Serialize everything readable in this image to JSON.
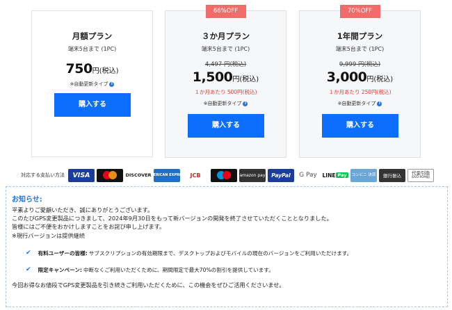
{
  "plans": [
    {
      "name": "月額プラン",
      "devices": "端末5台まで (1PC)",
      "price": "750",
      "price_unit": "円(税込)",
      "renewal": "※自動更新タイプ",
      "buy_label": "購入する"
    },
    {
      "badge": "66%OFF",
      "name": "３か月プラン",
      "devices": "端末5台まで (1PC)",
      "original_price": "4,497 円(税込)",
      "price": "1,500",
      "price_unit": "円(税込)",
      "per_month": "１か月あたり 500円(税込)",
      "renewal": "※自動更新タイプ",
      "buy_label": "購入する"
    },
    {
      "badge": "70%OFF",
      "name": "1年間プラン",
      "devices": "端末5台まで (1PC)",
      "original_price": "9,999 円(税込)",
      "price": "3,000",
      "price_unit": "円(税込)",
      "per_month": "１か月あたり 250円(税込)",
      "renewal": "※自動更新タイプ",
      "buy_label": "購入する"
    }
  ],
  "info_icon": "i",
  "payments": {
    "label": "対応する支払い方法",
    "methods": {
      "visa": "VISA",
      "discover": "DISCOVER",
      "amex": "AMERICAN EXPRESS",
      "jcb": "JCB",
      "amazon": "amazon pay",
      "paypal": "PayPal",
      "gpay": "G Pay",
      "line_text": "LINE",
      "line_pay": "Pay",
      "konbini": "コンビニ 決済",
      "bank": "銀行振込",
      "cod": "代金引換",
      "cod_sub": "(DVD-ROM版)"
    }
  },
  "notice": {
    "title": "お知らせ:",
    "lines": [
      "平素よりご愛顧いただき、誠にありがとうございます。",
      "このたびGPS変更製品につきまして、2024年9月30日をもって新バージョンの開発を終了させていただくこととなりました。",
      "皆様にはご不便をおかけしますことをお詫び申し上げます。",
      "※現行バージョンは提供継続"
    ],
    "bullets": [
      {
        "bold": "有料ユーザーの皆様:",
        "text": "サブスクリプションの有効期限まで、デスクトップおよびモバイルの現在のバージョンをご利用いただけます。"
      },
      {
        "bold": "限定キャンペーン:",
        "text": "中断なくご利用いただくために、期間限定で最大70%の割引を提供しています。"
      }
    ],
    "closing": "今回お得なお値段でGPS変更製品を引き続きご利用いただくために、この機会をぜひご活用くださいませ。"
  },
  "colors": {
    "accent": "#0d6efd",
    "badge": "#f26b6b",
    "discount_text": "#e53935",
    "notice_title": "#1f73e6"
  }
}
